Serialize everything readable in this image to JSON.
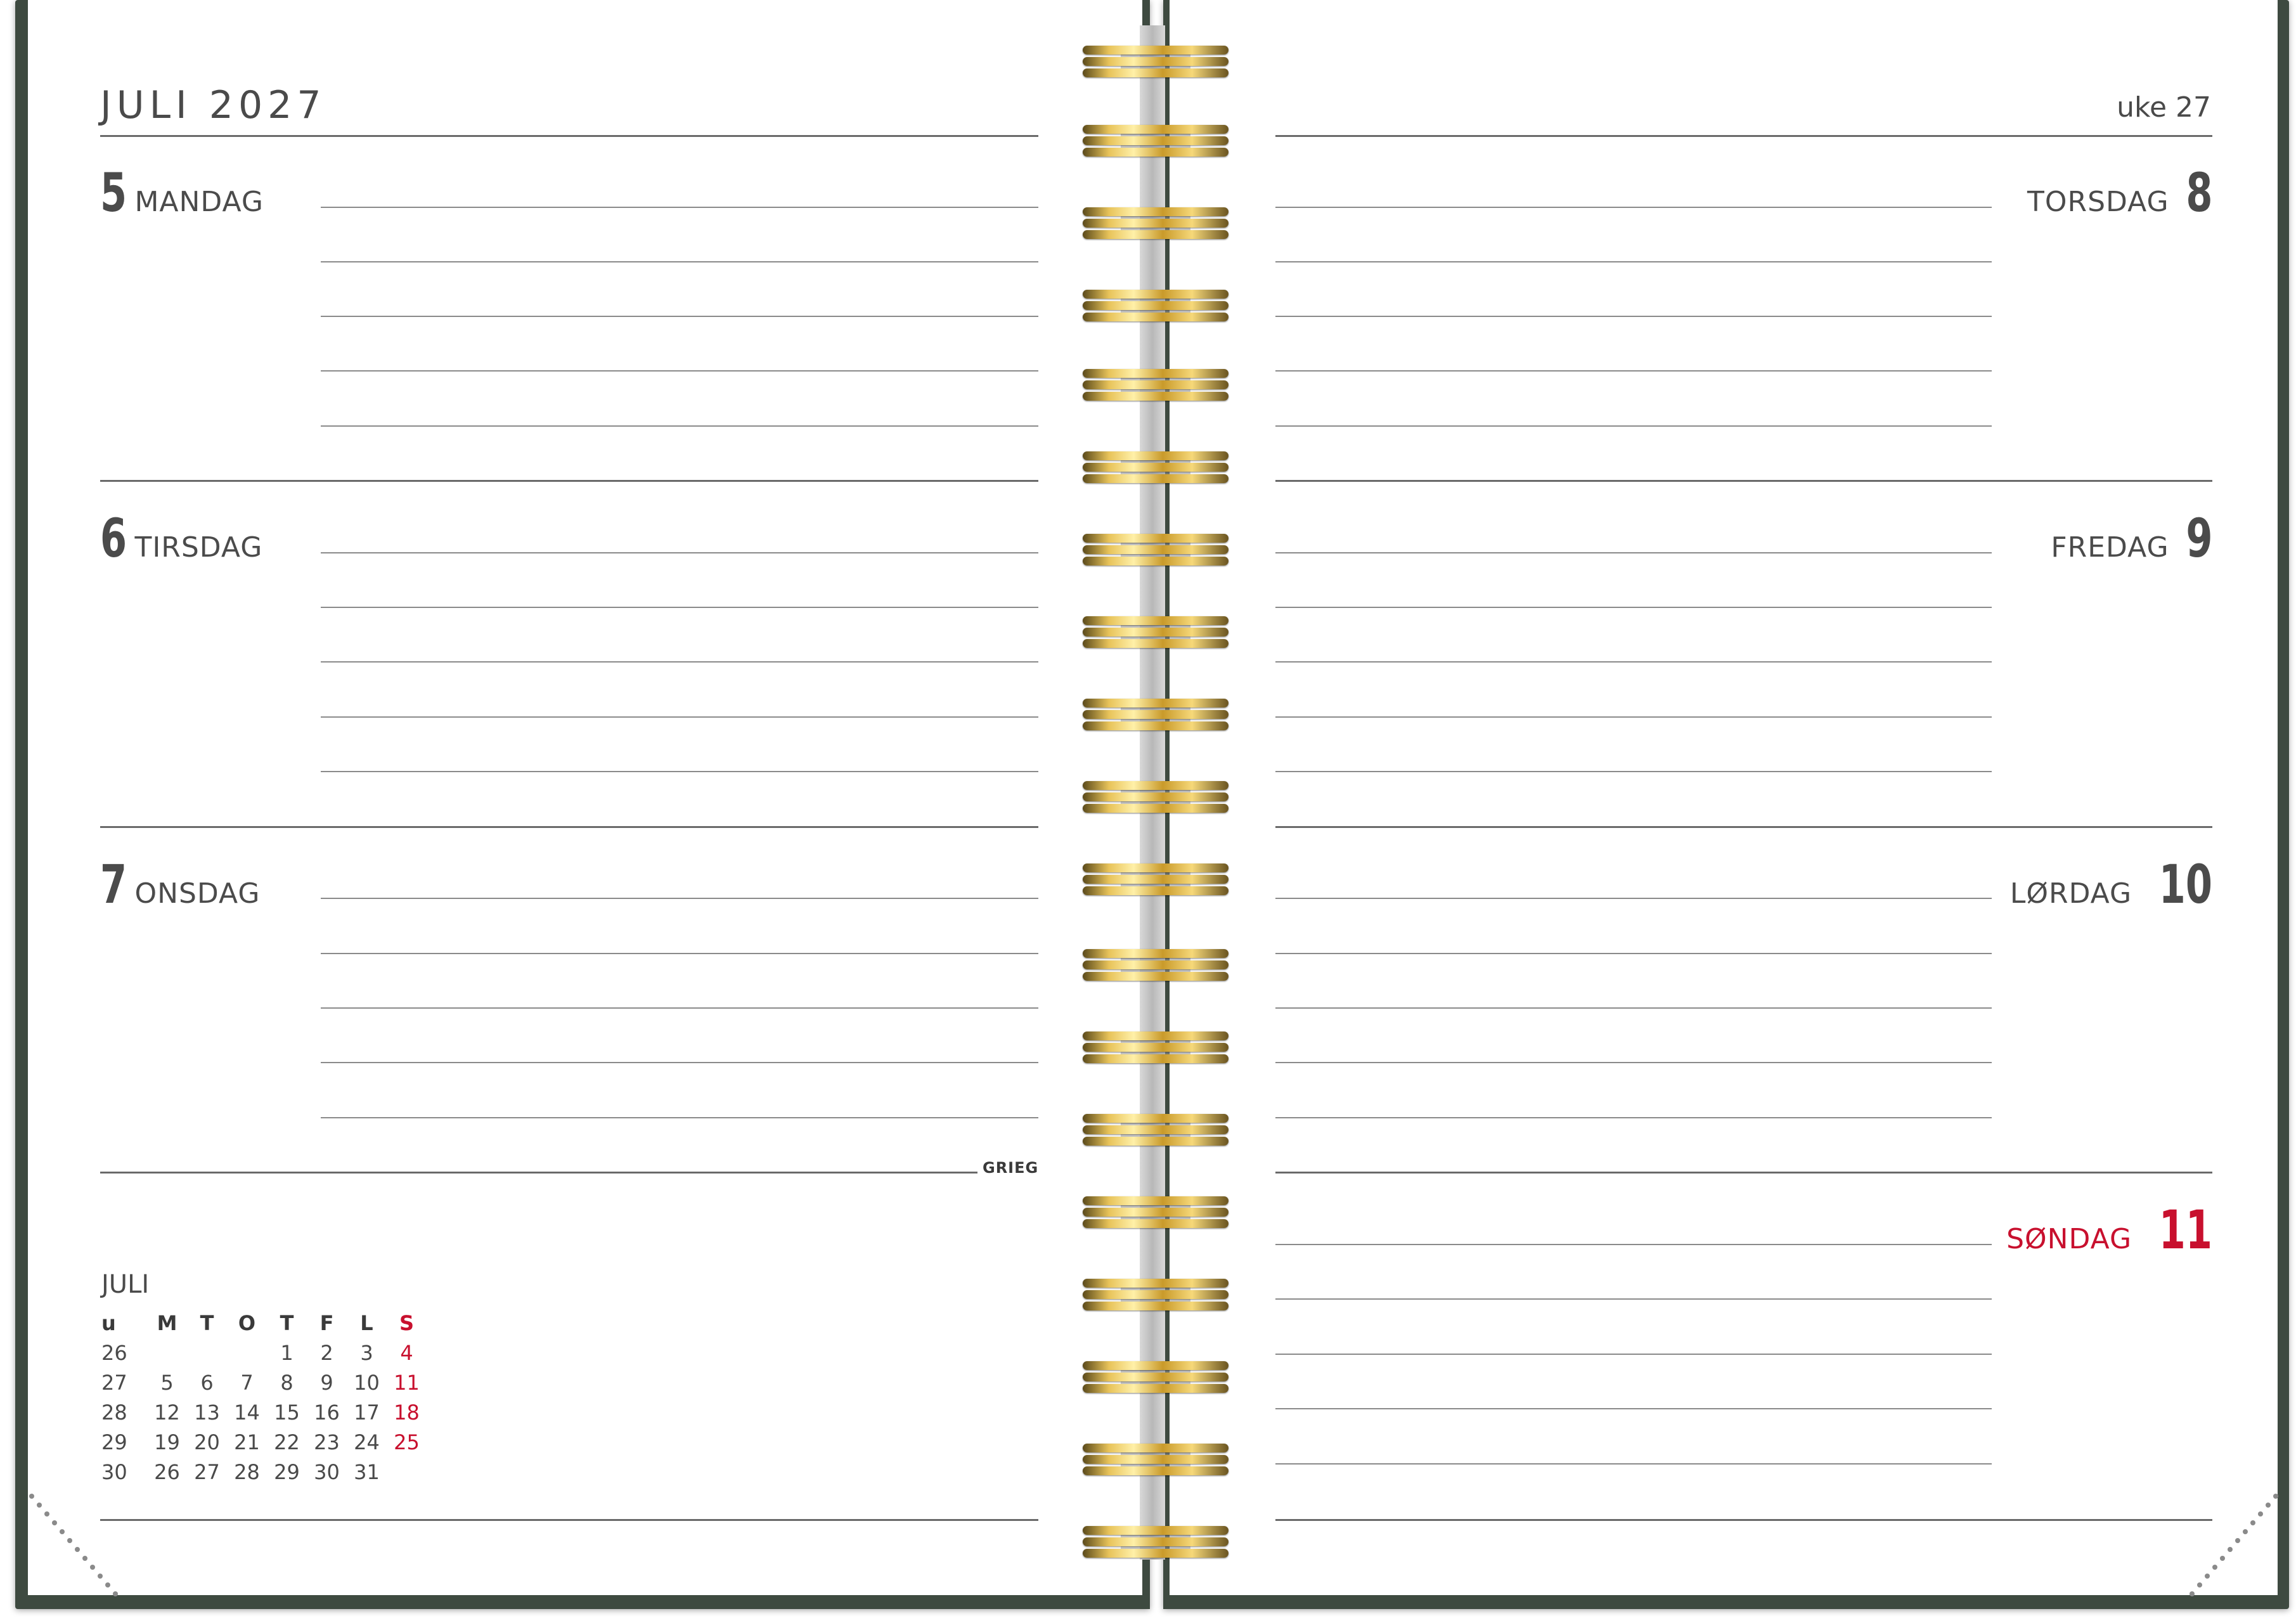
{
  "header": {
    "month_title": "JULI 2027",
    "week_label": "uke 27"
  },
  "days": {
    "mon": {
      "num": "5",
      "name": "MANDAG"
    },
    "tue": {
      "num": "6",
      "name": "TIRSDAG"
    },
    "wed": {
      "num": "7",
      "name": "ONSDAG"
    },
    "thu": {
      "num": "8",
      "name": "TORSDAG"
    },
    "fri": {
      "num": "9",
      "name": "FREDAG"
    },
    "sat": {
      "num": "10",
      "name": "LØRDAG"
    },
    "sun": {
      "num": "11",
      "name": "SØNDAG"
    }
  },
  "brand": "GRIEG",
  "mini_calendar": {
    "title": "JULI",
    "headers": [
      "u",
      "M",
      "T",
      "O",
      "T",
      "F",
      "L",
      "S"
    ],
    "rows": [
      [
        "26",
        "",
        "",
        "",
        "1",
        "2",
        "3",
        "4"
      ],
      [
        "27",
        "5",
        "6",
        "7",
        "8",
        "9",
        "10",
        "11"
      ],
      [
        "28",
        "12",
        "13",
        "14",
        "15",
        "16",
        "17",
        "18"
      ],
      [
        "29",
        "19",
        "20",
        "21",
        "22",
        "23",
        "24",
        "25"
      ],
      [
        "30",
        "26",
        "27",
        "28",
        "29",
        "30",
        "31",
        ""
      ]
    ]
  },
  "colors": {
    "cover": "#3e4a40",
    "sunday_red": "#c8102e",
    "text": "#4b4b4b",
    "spiral_gold": "#e8c35a"
  }
}
